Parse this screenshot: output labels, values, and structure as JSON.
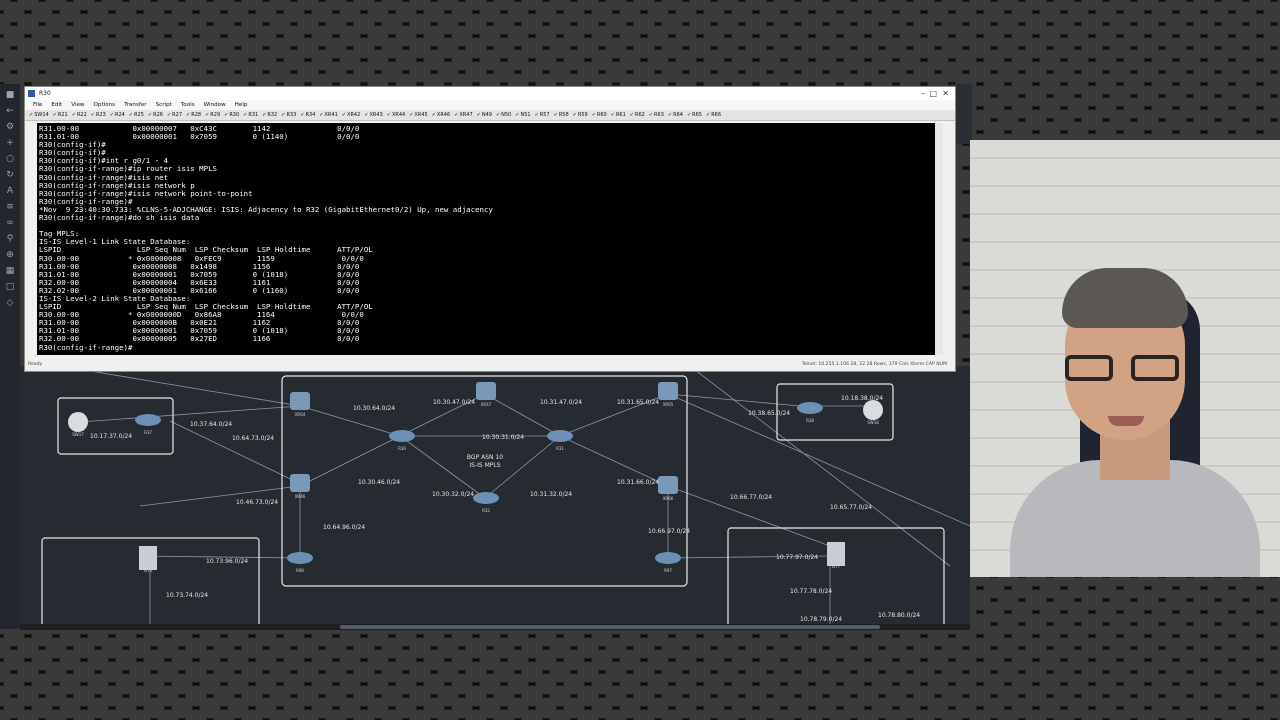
{
  "window": {
    "title": "R30",
    "controls": [
      "–",
      "□",
      "✕"
    ]
  },
  "menu": [
    "File",
    "Edit",
    "View",
    "Options",
    "Transfer",
    "Script",
    "Tools",
    "Window",
    "Help"
  ],
  "tabs": [
    "SW14",
    "R21",
    "R22",
    "R23",
    "R24",
    "R25",
    "R26",
    "R27",
    "R28",
    "R29",
    "R30",
    "R31",
    "R32",
    "R33",
    "R34",
    "XR41",
    "XR42",
    "XR43",
    "XR44",
    "XR45",
    "XR46",
    "XR47",
    "N49",
    "N50",
    "N51",
    "R57",
    "R58",
    "R59",
    "R60",
    "R61",
    "R62",
    "R63",
    "R64",
    "R65",
    "R66"
  ],
  "terminal": {
    "lines": [
      "R31.00-00            0x00000007   0xC43C        1142               0/0/0",
      "R31.01-00            0x00000001   0x7059        0 (1140)           0/0/0",
      "R30(config-if)#",
      "R30(config-if)#",
      "R30(config-if)#int r g0/1 - 4",
      "R30(config-if-range)#ip router isis MPLS",
      "R30(config-if-range)#isis net",
      "R30(config-if-range)#isis network p",
      "R30(config-if-range)#isis network point-to-point",
      "R30(config-if-range)#",
      "*Nov  9 23:40:30.733: %CLNS-5-ADJCHANGE: ISIS: Adjacency to R32 (GigabitEthernet0/2) Up, new adjacency",
      "R30(config-if-range)#do sh isis data",
      "",
      "Tag MPLS:",
      "IS-IS Level-1 Link State Database:",
      "LSPID                 LSP Seq Num  LSP Checksum  LSP Holdtime      ATT/P/OL",
      "R30.00-00           * 0x00000008   0xFEC9        1159               0/0/0",
      "R31.00-00            0x00000008   0x1498        1156               0/0/0",
      "R31.01-00            0x00000001   0x7059        0 (1018)           0/0/0",
      "R32.00-00            0x00000004   0x6E33        1161               0/0/0",
      "R32.02-00            0x00000001   0x6166        0 (1160)           0/0/0",
      "IS-IS Level-2 Link State Database:",
      "LSPID                 LSP Seq Num  LSP Checksum  LSP Holdtime      ATT/P/OL",
      "R30.00-00           * 0x0000000D   0x86A8        1164               0/0/0",
      "R31.00-00            0x0000000B   0x0E21        1162               0/0/0",
      "R31.01-00            0x00000001   0x7059        0 (1018)           0/0/0",
      "R32.00-00            0x00000005   0x27ED        1166               0/0/0",
      "R30(config-if-range)#"
    ]
  },
  "status": {
    "left": "Ready",
    "right": "Telnet: 10.255.1.106        28, 22  28 Rows, 179 Cols  Xterm        CAP  NUM"
  },
  "topology": {
    "area_label": "BGP ASN 10",
    "area_sublabel": "IS-IS MPLS",
    "subnets": [
      "10.30.64.0/24",
      "10.30.47.0/24",
      "10.31.47.0/24",
      "10.31.65.0/24",
      "10.30.31.0/24",
      "10.30.46.0/24",
      "10.30.32.0/24",
      "10.31.32.0/24",
      "10.31.66.0/24",
      "10.64.96.0/24",
      "10.66.97.0/24",
      "10.17.37.0/24",
      "10.37.64.0/24",
      "10.64.73.0/24",
      "10.46.73.0/24",
      "10.73.96.0/24",
      "10.73.74.0/24",
      "10.38.65.0/24",
      "10.18.38.0/24",
      "10.66.77.0/24",
      "10.65.77.0/24",
      "10.77.97.0/24",
      "10.77.78.0/24",
      "10.78.79.0/24",
      "10.78.80.0/24"
    ],
    "nodes": [
      "SW17",
      "R37",
      "XR64",
      "R30",
      "XR47",
      "R31",
      "XR65",
      "XR46",
      "R32",
      "XR66",
      "R96",
      "R97",
      "N73",
      "R38",
      "SW18",
      "N77"
    ],
    "colors": {
      "canvas": "#262b31",
      "link": "#8a96a3",
      "router": "#6d8fb5"
    }
  }
}
